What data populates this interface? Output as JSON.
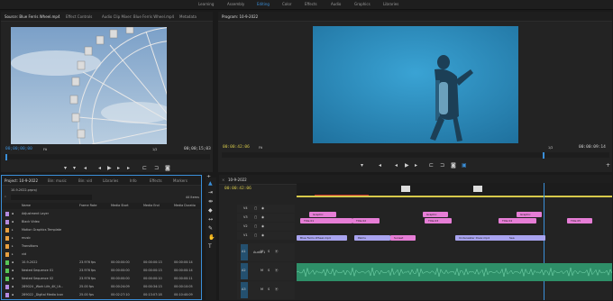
{
  "workspaces": [
    "Learning",
    "Assembly",
    "Editing",
    "Color",
    "Effects",
    "Audio",
    "Graphics",
    "Libraries"
  ],
  "active_workspace": "Editing",
  "source": {
    "tabs": [
      "Source: Blue Ferris Wheel.mp4",
      "Effect Controls",
      "Audio Clip Mixer: Blue Ferris Wheel.mp4",
      "Metadata"
    ],
    "timecode": "00;00;00;00",
    "fit": "Fit",
    "scale": "1/2",
    "duration": "00;00;15;03"
  },
  "program": {
    "title": "Program: 10-9-2022",
    "timecode": "00:00:42:06",
    "fit": "Fit",
    "scale": "1/2",
    "duration": "00:00:09:14"
  },
  "project": {
    "tabs": [
      "Project: 10-9-2022",
      "Bin: music",
      "Bin: vid",
      "Libraries",
      "Info",
      "Effects",
      "Markers"
    ],
    "filename": "10-9-2022.prproj",
    "item_count": "44 Items",
    "columns": [
      "Name",
      "Frame Rate",
      "Media Start",
      "Media End",
      "Media Duratio"
    ],
    "rows": [
      {
        "name": "Adjustment Layer",
        "fps": "",
        "start": "",
        "end": "",
        "dur": "",
        "color": "#b48be0",
        "type": "file"
      },
      {
        "name": "Black Video",
        "fps": "",
        "start": "",
        "end": "",
        "dur": "",
        "color": "#b48be0",
        "type": "file"
      },
      {
        "name": "Motion Graphics Template",
        "fps": "",
        "start": "",
        "end": "",
        "dur": "",
        "color": "#e8a040",
        "type": "bin"
      },
      {
        "name": "music",
        "fps": "",
        "start": "",
        "end": "",
        "dur": "",
        "color": "#e8a040",
        "type": "bin"
      },
      {
        "name": "Transitions",
        "fps": "",
        "start": "",
        "end": "",
        "dur": "",
        "color": "#e8a040",
        "type": "bin"
      },
      {
        "name": "vid",
        "fps": "",
        "start": "",
        "end": "",
        "dur": "",
        "color": "#e8a040",
        "type": "bin"
      },
      {
        "name": "10-9-2022",
        "fps": "23.976 fps",
        "start": "00:00:00:00",
        "end": "00:00:00:13",
        "dur": "00:00:00:14",
        "color": "#57c657",
        "type": "seq"
      },
      {
        "name": "Nested Sequence 01",
        "fps": "23.976 fps",
        "start": "00:00:00:00",
        "end": "00:00:00:13",
        "dur": "00:00:00:14",
        "color": "#57c657",
        "type": "seq"
      },
      {
        "name": "Nested Sequence 02",
        "fps": "23.976 fps",
        "start": "00:00:00:00",
        "end": "00:00:00:10",
        "dur": "00:00:00:11",
        "color": "#57c657",
        "type": "seq"
      },
      {
        "name": "289024 _Work Life_4K_Ut...",
        "fps": "25.00 fps",
        "start": "00:00:24:09",
        "end": "00:00:34:13",
        "dur": "00:00:10:05",
        "color": "#b48be0",
        "type": "file"
      },
      {
        "name": "289022 _Digital Media Icon",
        "fps": "25.00 fps",
        "start": "00:02:27:10",
        "end": "00:13:07:18",
        "dur": "00:10:40:09",
        "color": "#b48be0",
        "type": "file"
      }
    ]
  },
  "timeline": {
    "tab": "10-9-2022",
    "timecode": "00:00:42:06",
    "video_tracks": [
      "V4",
      "V3",
      "V2",
      "V1"
    ],
    "audio_tracks": [
      "A1",
      "A2",
      "A3"
    ],
    "audio_track_name": "Audio 1",
    "clips_v3": [
      {
        "label": "Graphic",
        "color": "#e67dd6"
      },
      {
        "label": "Graphic",
        "color": "#e67dd6"
      },
      {
        "label": "Graphic",
        "color": "#e67dd6"
      }
    ],
    "clips_v2": [
      {
        "label": "Title 01",
        "color": "#e67dd6"
      },
      {
        "label": "Title 02",
        "color": "#e67dd6"
      },
      {
        "label": "Title 03",
        "color": "#e67dd6"
      },
      {
        "label": "Title 04",
        "color": "#e67dd6"
      },
      {
        "label": "Title 05",
        "color": "#e67dd6"
      }
    ],
    "clips_v1": [
      {
        "label": "Blue Ferris Wheel.mp4",
        "color": "#a9a4f0"
      },
      {
        "label": "Palms",
        "color": "#a9a4f0"
      },
      {
        "label": "Sunset",
        "color": "#e67dd6"
      },
      {
        "label": "Underwater Diver.mp4",
        "color": "#a9a4f0"
      },
      {
        "label": "Sea",
        "color": "#a9a4f0"
      }
    ],
    "colors": {
      "accent": "#3a8fd9",
      "playhead": "#3a8fd9",
      "audio": "#2e8f68",
      "work_area": "#d6c94a"
    }
  },
  "icons": [
    "selection-tool-icon",
    "track-select-icon",
    "ripple-edit-icon",
    "razor-icon",
    "slip-icon",
    "pen-icon",
    "hand-icon",
    "type-icon"
  ]
}
